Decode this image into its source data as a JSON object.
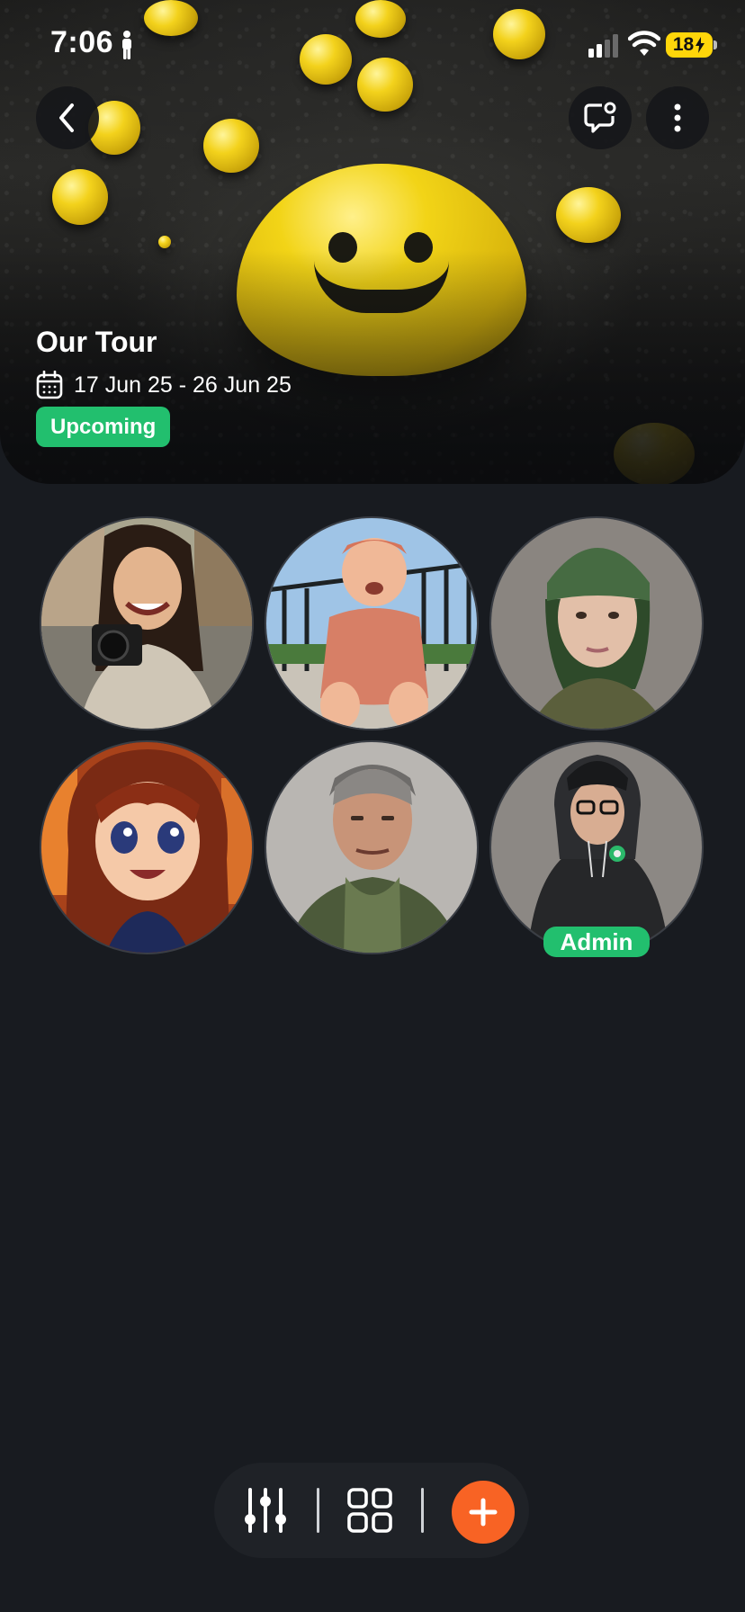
{
  "status_bar": {
    "time": "7:06",
    "battery": "18"
  },
  "trip": {
    "title": "Our Tour",
    "date_range": "17 Jun 25 - 26 Jun 25",
    "status": "Upcoming"
  },
  "members": [
    {
      "role": ""
    },
    {
      "role": ""
    },
    {
      "role": ""
    },
    {
      "role": ""
    },
    {
      "role": ""
    },
    {
      "role": "Admin"
    }
  ],
  "colors": {
    "background": "#181b20",
    "accent_green": "#22bf6e",
    "accent_orange": "#f86324",
    "battery_yellow": "#ffd60a"
  },
  "icons": {
    "back": "chevron-left-icon",
    "chat": "chat-bubble-icon",
    "more": "more-vertical-icon",
    "calendar": "calendar-icon",
    "filter": "sliders-icon",
    "grid": "grid-icon",
    "add": "plus-icon"
  }
}
